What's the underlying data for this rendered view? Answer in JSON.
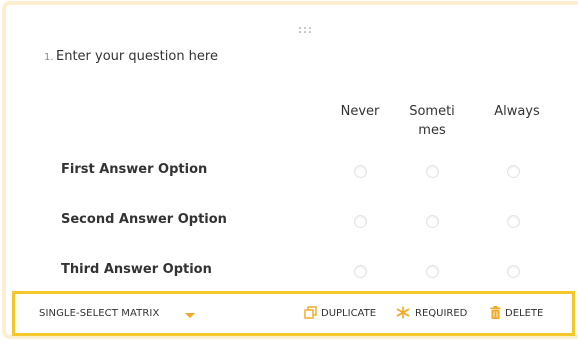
{
  "question": {
    "number": "1.",
    "text": "Enter your question here"
  },
  "columns": [
    "Never",
    "Sometimes",
    "Always"
  ],
  "rows": [
    "First Answer Option",
    "Second Answer Option",
    "Third Answer Option"
  ],
  "toolbar": {
    "question_type": "SINGLE-SELECT MATRIX",
    "duplicate_label": "DUPLICATE",
    "required_label": "REQUIRED",
    "delete_label": "DELETE"
  },
  "colors": {
    "card_border": "#fcefcf",
    "toolbar_border": "#f5c82a",
    "accent": "#f5a623"
  },
  "icons": [
    "drag-handle-icon",
    "caret-down-icon",
    "duplicate-icon",
    "asterisk-icon",
    "trash-icon"
  ]
}
